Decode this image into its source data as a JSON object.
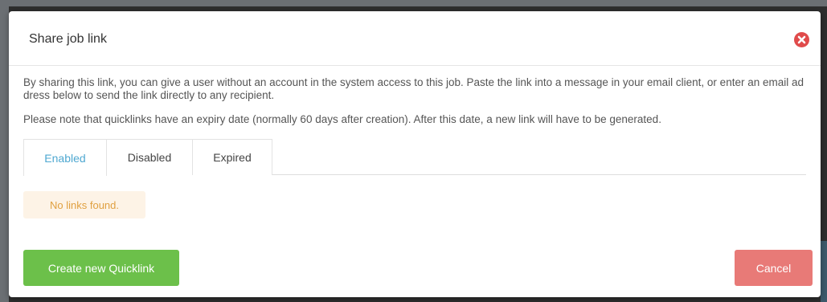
{
  "modal": {
    "title": "Share job link",
    "close_icon": "close-circle-icon",
    "description": "By sharing this link, you can give a user without an account in the system access to this job. Paste the link into a message in your email client, or enter an email address below to send the link directly to any recipient.",
    "note": "Please note that quicklinks have an expiry date (normally 60 days after creation). After this date, a new link will have to be generated.",
    "tabs": [
      {
        "label": "Enabled",
        "active": true
      },
      {
        "label": "Disabled",
        "active": false
      },
      {
        "label": "Expired",
        "active": false
      }
    ],
    "empty_message": "No links found.",
    "create_label": "Create new Quicklink",
    "cancel_label": "Cancel"
  },
  "colors": {
    "active_tab": "#4fa8d1",
    "create_button": "#6cc04a",
    "cancel_button": "#e87a77",
    "close_icon": "#e04b4b",
    "warning_text": "#e0a040",
    "warning_bg": "#fdf3e6"
  }
}
